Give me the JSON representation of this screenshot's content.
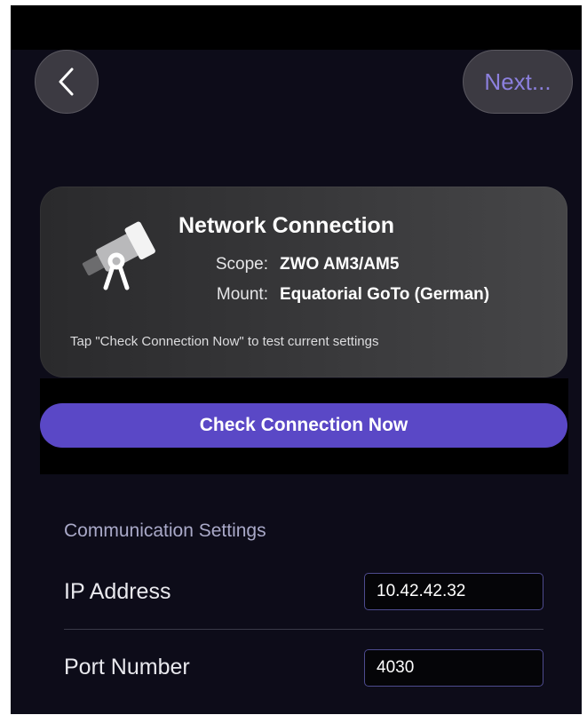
{
  "nav": {
    "back_icon": "chevron-left-icon",
    "next_label": "Next..."
  },
  "card": {
    "icon": "telescope-icon",
    "title": "Network Connection",
    "scope_label": "Scope:",
    "scope_value": "ZWO AM3/AM5",
    "mount_label": "Mount:",
    "mount_value": "Equatorial GoTo (German)",
    "hint": "Tap \"Check Connection Now\" to test current settings"
  },
  "check_button": {
    "label": "Check Connection Now"
  },
  "communication": {
    "section_title": "Communication Settings",
    "ip_label": "IP Address",
    "ip_value": "10.42.42.32",
    "port_label": "Port Number",
    "port_value": "4030"
  },
  "colors": {
    "background": "#0d0c19",
    "accent": "#5a48c6",
    "next_text": "#8c80de",
    "section_text": "#a9a9c8"
  }
}
